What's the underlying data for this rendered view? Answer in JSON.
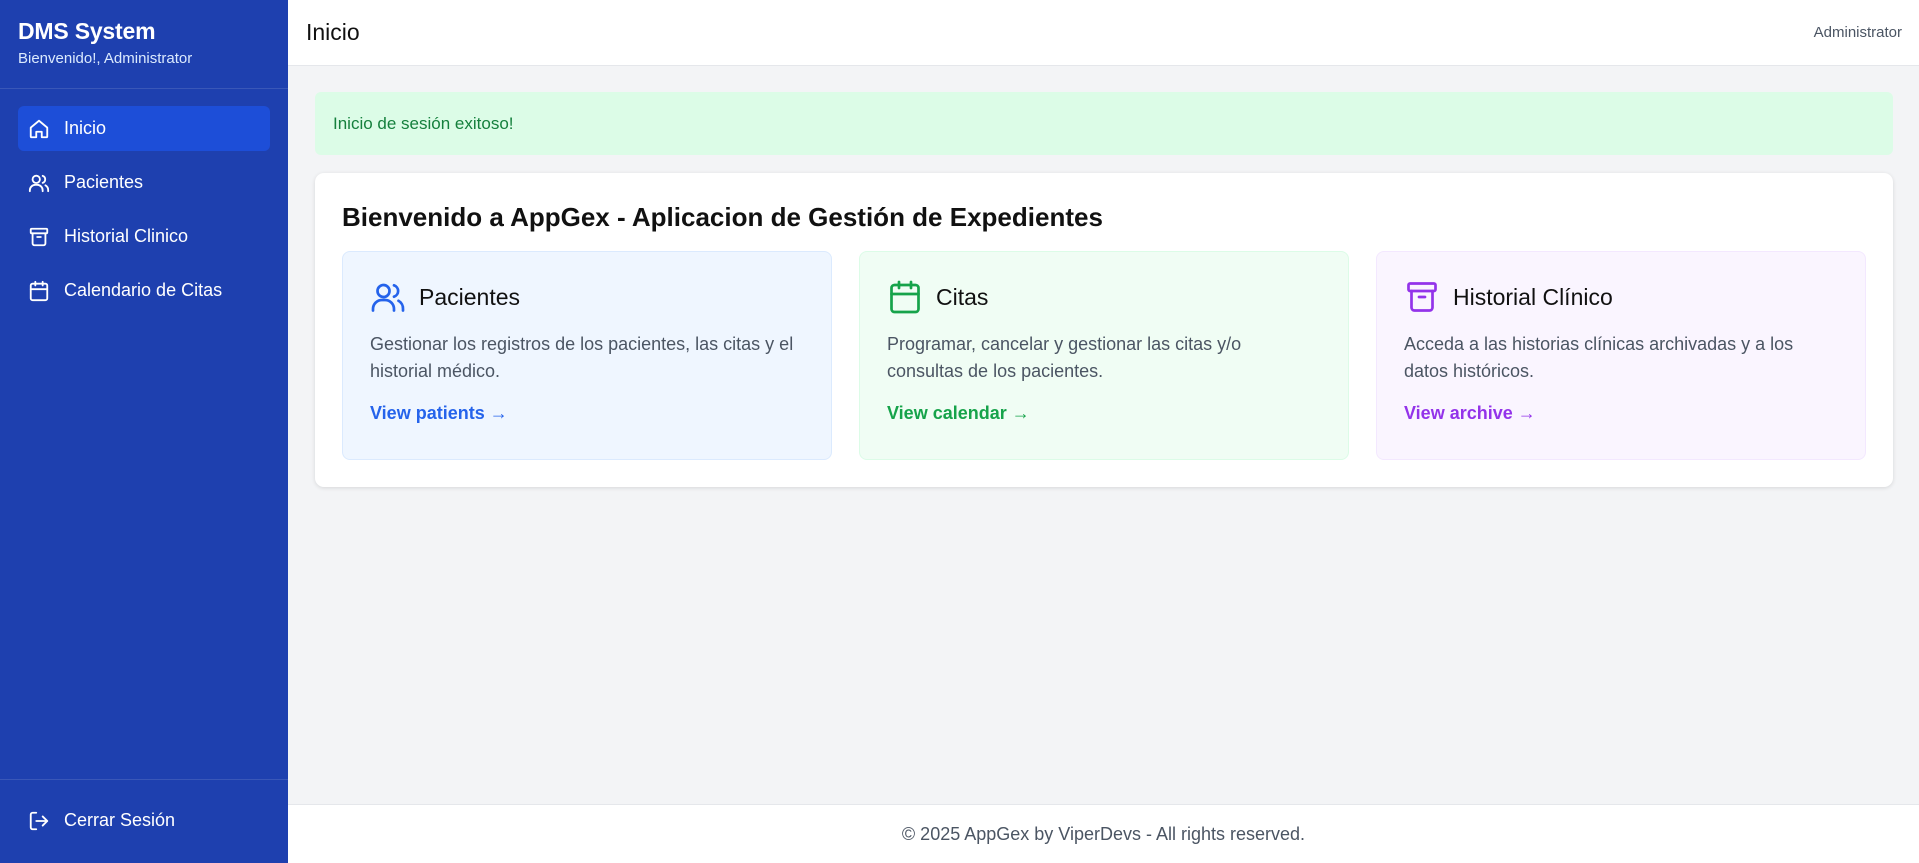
{
  "sidebar": {
    "brand_title": "DMS System",
    "brand_subtitle": "Bienvenido!, Administrator",
    "items": [
      {
        "label": "Inicio",
        "icon": "home-icon",
        "active": true
      },
      {
        "label": "Pacientes",
        "icon": "users-icon",
        "active": false
      },
      {
        "label": "Historial Clinico",
        "icon": "archive-icon",
        "active": false
      },
      {
        "label": "Calendario de Citas",
        "icon": "calendar-icon",
        "active": false
      }
    ],
    "logout_label": "Cerrar Sesión"
  },
  "header": {
    "title": "Inicio",
    "user": "Administrator"
  },
  "alert": {
    "message": "Inicio de sesión exitoso!"
  },
  "welcome": {
    "title": "Bienvenido a AppGex - Aplicacion de Gestión de Expedientes",
    "cards": [
      {
        "title": "Pacientes",
        "description": "Gestionar los registros de los pacientes, las citas y el historial médico.",
        "link": "View patients →",
        "icon": "users-icon",
        "color": "#2563eb"
      },
      {
        "title": "Citas",
        "description": "Programar, cancelar y gestionar las citas y/o consultas de los pacientes.",
        "link": "View calendar →",
        "icon": "calendar-icon",
        "color": "#16a34a"
      },
      {
        "title": "Historial Clínico",
        "description": "Acceda a las historias clínicas archivadas y a los datos históricos.",
        "link": "View archive →",
        "icon": "archive-icon",
        "color": "#9333ea"
      }
    ]
  },
  "footer": {
    "text": "© 2025 AppGex by ViperDevs - All rights reserved."
  },
  "colors": {
    "sidebar_bg": "#1e40af",
    "sidebar_active": "#1d4ed8",
    "alert_bg": "#dcfce7",
    "alert_text": "#15803d"
  }
}
